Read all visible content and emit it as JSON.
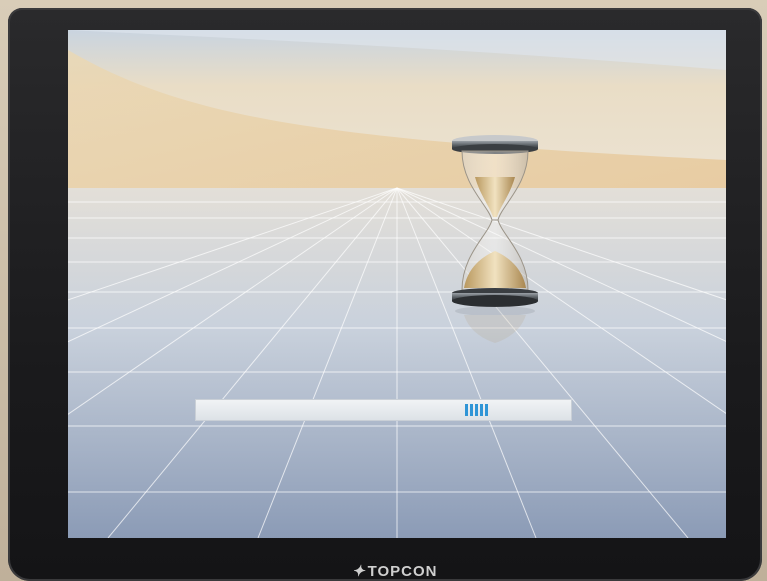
{
  "device": {
    "brand": "TOPCON"
  },
  "screen": {
    "state": "loading",
    "busy_indicator": "hourglass-icon",
    "progress": {
      "segments_filled": 5
    }
  },
  "colors": {
    "progress_segment": "#2f95d6",
    "bezel": "#1f1f21"
  }
}
